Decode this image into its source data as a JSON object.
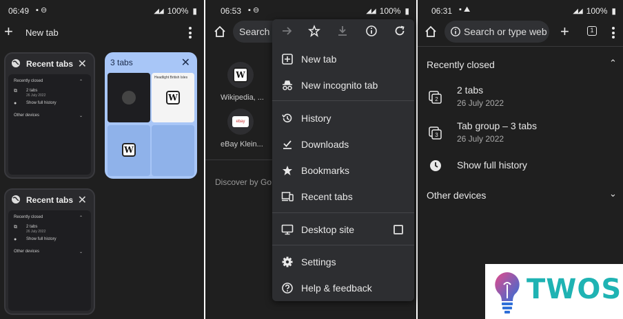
{
  "panel1": {
    "status": {
      "time": "06:49",
      "battery": "100%"
    },
    "title": "New tab",
    "card1": {
      "title": "Recent tabs",
      "recently_closed": "Recently closed",
      "item1_title": "2 tabs",
      "item1_sub": "26 July 2022",
      "item2_title": "Show full history",
      "other_devices": "Other devices"
    },
    "card2": {
      "title": "Recent tabs",
      "recently_closed": "Recently closed",
      "item1_title": "2 tabs",
      "item1_sub": "26 July 2022",
      "item2_title": "Show full history",
      "other_devices": "Other devices"
    },
    "group_card": {
      "title": "3 tabs",
      "w_badge": "W",
      "thumb_title": "Headlight British Isles"
    }
  },
  "panel2": {
    "status": {
      "time": "06:53",
      "battery": "100%"
    },
    "search_placeholder": "Search",
    "tiles": [
      {
        "label": "Wikipedia, ...",
        "badge": "W"
      },
      {
        "label": "eBay Klein...",
        "badge": "ebay"
      }
    ],
    "discover_label": "Discover by Go",
    "menu": {
      "items": [
        {
          "label": "New tab",
          "icon": "new-tab-icon"
        },
        {
          "label": "New incognito tab",
          "icon": "incognito-icon"
        },
        {
          "label": "History",
          "icon": "history-icon"
        },
        {
          "label": "Downloads",
          "icon": "downloads-icon"
        },
        {
          "label": "Bookmarks",
          "icon": "star-icon"
        },
        {
          "label": "Recent tabs",
          "icon": "devices-icon"
        },
        {
          "label": "Desktop site",
          "icon": "desktop-icon"
        },
        {
          "label": "Settings",
          "icon": "gear-icon"
        },
        {
          "label": "Help & feedback",
          "icon": "help-icon"
        }
      ]
    }
  },
  "panel3": {
    "status": {
      "time": "06:31",
      "battery": "100%"
    },
    "omnibox_placeholder": "Search or type web",
    "tab_count": "1",
    "recently_closed": "Recently closed",
    "items": [
      {
        "title": "2 tabs",
        "sub": "26 July 2022",
        "badge": "2"
      },
      {
        "title": "Tab group – 3 tabs",
        "sub": "26 July 2022",
        "badge": "3"
      },
      {
        "title": "Show full history",
        "sub": ""
      }
    ],
    "other_devices": "Other devices"
  },
  "watermark": {
    "text": "TWOS",
    "color": "#1fb3b3"
  }
}
